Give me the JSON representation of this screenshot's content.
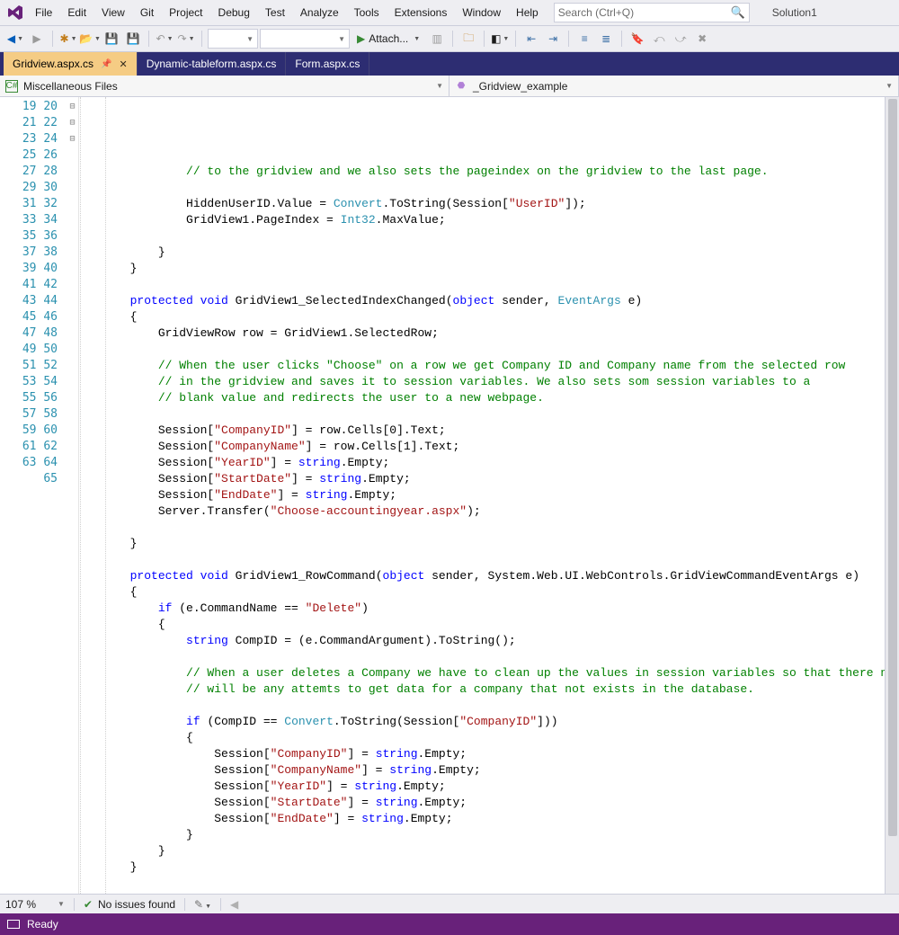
{
  "menu": {
    "items": [
      "File",
      "Edit",
      "View",
      "Git",
      "Project",
      "Debug",
      "Test",
      "Analyze",
      "Tools",
      "Extensions",
      "Window",
      "Help"
    ]
  },
  "search": {
    "placeholder": "Search (Ctrl+Q)"
  },
  "solution": {
    "name": "Solution1"
  },
  "toolbar": {
    "attach_label": "Attach..."
  },
  "tabs": [
    {
      "label": "Gridview.aspx.cs",
      "active": true,
      "pinned": true
    },
    {
      "label": "Dynamic-tableform.aspx.cs",
      "active": false,
      "pinned": false
    },
    {
      "label": "Form.aspx.cs",
      "active": false,
      "pinned": false
    }
  ],
  "nav": {
    "left": "Miscellaneous Files",
    "right": "_Gridview_example"
  },
  "gutter": {
    "start": 19,
    "end": 65
  },
  "fold": {
    "27": "⊟",
    "28": "",
    "46": "⊟",
    "53": "⊟"
  },
  "code_lines": [
    {
      "n": 19,
      "seg": [
        {
          "t": "            ",
          "c": "n"
        },
        {
          "t": "// to the gridview and we also sets the pageindex on the gridview to the last page.",
          "c": "c"
        }
      ]
    },
    {
      "n": 20,
      "seg": []
    },
    {
      "n": 21,
      "seg": [
        {
          "t": "            HiddenUserID.Value = ",
          "c": "n"
        },
        {
          "t": "Convert",
          "c": "t"
        },
        {
          "t": ".ToString(Session[",
          "c": "n"
        },
        {
          "t": "\"UserID\"",
          "c": "s"
        },
        {
          "t": "]);",
          "c": "n"
        }
      ]
    },
    {
      "n": 22,
      "seg": [
        {
          "t": "            GridView1.PageIndex = ",
          "c": "n"
        },
        {
          "t": "Int32",
          "c": "t"
        },
        {
          "t": ".MaxValue;",
          "c": "n"
        }
      ]
    },
    {
      "n": 23,
      "seg": []
    },
    {
      "n": 24,
      "seg": [
        {
          "t": "        }",
          "c": "n"
        }
      ]
    },
    {
      "n": 25,
      "seg": [
        {
          "t": "    }",
          "c": "n"
        }
      ]
    },
    {
      "n": 26,
      "seg": []
    },
    {
      "n": 27,
      "seg": [
        {
          "t": "    ",
          "c": "n"
        },
        {
          "t": "protected",
          "c": "k"
        },
        {
          "t": " ",
          "c": "n"
        },
        {
          "t": "void",
          "c": "k"
        },
        {
          "t": " GridView1_SelectedIndexChanged(",
          "c": "n"
        },
        {
          "t": "object",
          "c": "k"
        },
        {
          "t": " sender, ",
          "c": "n"
        },
        {
          "t": "EventArgs",
          "c": "t"
        },
        {
          "t": " e)",
          "c": "n"
        }
      ]
    },
    {
      "n": 28,
      "seg": [
        {
          "t": "    {",
          "c": "n"
        }
      ]
    },
    {
      "n": 29,
      "seg": [
        {
          "t": "        GridViewRow row = GridView1.SelectedRow;",
          "c": "n"
        }
      ]
    },
    {
      "n": 30,
      "seg": []
    },
    {
      "n": 31,
      "seg": [
        {
          "t": "        ",
          "c": "n"
        },
        {
          "t": "// When the user clicks \"Choose\" on a row we get Company ID and Company name from the selected row",
          "c": "c"
        }
      ]
    },
    {
      "n": 32,
      "seg": [
        {
          "t": "        ",
          "c": "n"
        },
        {
          "t": "// in the gridview and saves it to session variables. We also sets som session variables to a",
          "c": "c"
        }
      ]
    },
    {
      "n": 33,
      "seg": [
        {
          "t": "        ",
          "c": "n"
        },
        {
          "t": "// blank value and redirects the user to a new webpage.",
          "c": "c"
        }
      ]
    },
    {
      "n": 34,
      "seg": []
    },
    {
      "n": 35,
      "seg": [
        {
          "t": "        Session[",
          "c": "n"
        },
        {
          "t": "\"CompanyID\"",
          "c": "s"
        },
        {
          "t": "] = row.Cells[0].Text;",
          "c": "n"
        }
      ]
    },
    {
      "n": 36,
      "seg": [
        {
          "t": "        Session[",
          "c": "n"
        },
        {
          "t": "\"CompanyName\"",
          "c": "s"
        },
        {
          "t": "] = row.Cells[1].Text;",
          "c": "n"
        }
      ]
    },
    {
      "n": 37,
      "seg": [
        {
          "t": "        Session[",
          "c": "n"
        },
        {
          "t": "\"YearID\"",
          "c": "s"
        },
        {
          "t": "] = ",
          "c": "n"
        },
        {
          "t": "string",
          "c": "k"
        },
        {
          "t": ".Empty;",
          "c": "n"
        }
      ]
    },
    {
      "n": 38,
      "seg": [
        {
          "t": "        Session[",
          "c": "n"
        },
        {
          "t": "\"StartDate\"",
          "c": "s"
        },
        {
          "t": "] = ",
          "c": "n"
        },
        {
          "t": "string",
          "c": "k"
        },
        {
          "t": ".Empty;",
          "c": "n"
        }
      ]
    },
    {
      "n": 39,
      "seg": [
        {
          "t": "        Session[",
          "c": "n"
        },
        {
          "t": "\"EndDate\"",
          "c": "s"
        },
        {
          "t": "] = ",
          "c": "n"
        },
        {
          "t": "string",
          "c": "k"
        },
        {
          "t": ".Empty;",
          "c": "n"
        }
      ]
    },
    {
      "n": 40,
      "seg": [
        {
          "t": "        Server.Transfer(",
          "c": "n"
        },
        {
          "t": "\"Choose-accountingyear.aspx\"",
          "c": "s"
        },
        {
          "t": ");",
          "c": "n"
        }
      ]
    },
    {
      "n": 41,
      "seg": []
    },
    {
      "n": 42,
      "seg": [
        {
          "t": "    }",
          "c": "n"
        }
      ]
    },
    {
      "n": 43,
      "seg": []
    },
    {
      "n": 44,
      "seg": [
        {
          "t": "    ",
          "c": "n"
        },
        {
          "t": "protected",
          "c": "k"
        },
        {
          "t": " ",
          "c": "n"
        },
        {
          "t": "void",
          "c": "k"
        },
        {
          "t": " GridView1_RowCommand(",
          "c": "n"
        },
        {
          "t": "object",
          "c": "k"
        },
        {
          "t": " sender, System.Web.UI.WebControls.GridViewCommandEventArgs e)",
          "c": "n"
        }
      ]
    },
    {
      "n": 45,
      "seg": [
        {
          "t": "    {",
          "c": "n"
        }
      ]
    },
    {
      "n": 46,
      "seg": [
        {
          "t": "        ",
          "c": "n"
        },
        {
          "t": "if",
          "c": "k"
        },
        {
          "t": " (e.CommandName == ",
          "c": "n"
        },
        {
          "t": "\"Delete\"",
          "c": "s"
        },
        {
          "t": ")",
          "c": "n"
        }
      ]
    },
    {
      "n": 47,
      "seg": [
        {
          "t": "        {",
          "c": "n"
        }
      ]
    },
    {
      "n": 48,
      "seg": [
        {
          "t": "            ",
          "c": "n"
        },
        {
          "t": "string",
          "c": "k"
        },
        {
          "t": " CompID = (e.CommandArgument).ToString();",
          "c": "n"
        }
      ]
    },
    {
      "n": 49,
      "seg": []
    },
    {
      "n": 50,
      "seg": [
        {
          "t": "            ",
          "c": "n"
        },
        {
          "t": "// When a user deletes a Company we have to clean up the values in session variables so that there not",
          "c": "c"
        }
      ]
    },
    {
      "n": 51,
      "seg": [
        {
          "t": "            ",
          "c": "n"
        },
        {
          "t": "// will be any attemts to get data for a company that not exists in the database.",
          "c": "c"
        }
      ]
    },
    {
      "n": 52,
      "seg": []
    },
    {
      "n": 53,
      "seg": [
        {
          "t": "            ",
          "c": "n"
        },
        {
          "t": "if",
          "c": "k"
        },
        {
          "t": " (CompID == ",
          "c": "n"
        },
        {
          "t": "Convert",
          "c": "t"
        },
        {
          "t": ".ToString(Session[",
          "c": "n"
        },
        {
          "t": "\"CompanyID\"",
          "c": "s"
        },
        {
          "t": "]))",
          "c": "n"
        }
      ]
    },
    {
      "n": 54,
      "seg": [
        {
          "t": "            {",
          "c": "n"
        }
      ]
    },
    {
      "n": 55,
      "seg": [
        {
          "t": "                Session[",
          "c": "n"
        },
        {
          "t": "\"CompanyID\"",
          "c": "s"
        },
        {
          "t": "] = ",
          "c": "n"
        },
        {
          "t": "string",
          "c": "k"
        },
        {
          "t": ".Empty;",
          "c": "n"
        }
      ]
    },
    {
      "n": 56,
      "seg": [
        {
          "t": "                Session[",
          "c": "n"
        },
        {
          "t": "\"CompanyName\"",
          "c": "s"
        },
        {
          "t": "] = ",
          "c": "n"
        },
        {
          "t": "string",
          "c": "k"
        },
        {
          "t": ".Empty;",
          "c": "n"
        }
      ]
    },
    {
      "n": 57,
      "seg": [
        {
          "t": "                Session[",
          "c": "n"
        },
        {
          "t": "\"YearID\"",
          "c": "s"
        },
        {
          "t": "] = ",
          "c": "n"
        },
        {
          "t": "string",
          "c": "k"
        },
        {
          "t": ".Empty;",
          "c": "n"
        }
      ]
    },
    {
      "n": 58,
      "seg": [
        {
          "t": "                Session[",
          "c": "n"
        },
        {
          "t": "\"StartDate\"",
          "c": "s"
        },
        {
          "t": "] = ",
          "c": "n"
        },
        {
          "t": "string",
          "c": "k"
        },
        {
          "t": ".Empty;",
          "c": "n"
        }
      ]
    },
    {
      "n": 59,
      "seg": [
        {
          "t": "                Session[",
          "c": "n"
        },
        {
          "t": "\"EndDate\"",
          "c": "s"
        },
        {
          "t": "] = ",
          "c": "n"
        },
        {
          "t": "string",
          "c": "k"
        },
        {
          "t": ".Empty;",
          "c": "n"
        }
      ]
    },
    {
      "n": 60,
      "seg": [
        {
          "t": "            }",
          "c": "n"
        }
      ]
    },
    {
      "n": 61,
      "seg": [
        {
          "t": "        }",
          "c": "n"
        }
      ]
    },
    {
      "n": 62,
      "seg": [
        {
          "t": "    }",
          "c": "n"
        }
      ]
    },
    {
      "n": 63,
      "seg": []
    },
    {
      "n": 64,
      "seg": [
        {
          "t": "}",
          "c": "n"
        }
      ]
    },
    {
      "n": 65,
      "seg": []
    }
  ],
  "editor_status": {
    "zoom": "107 %",
    "issues": "No issues found"
  },
  "statusbar": {
    "ready": "Ready"
  }
}
